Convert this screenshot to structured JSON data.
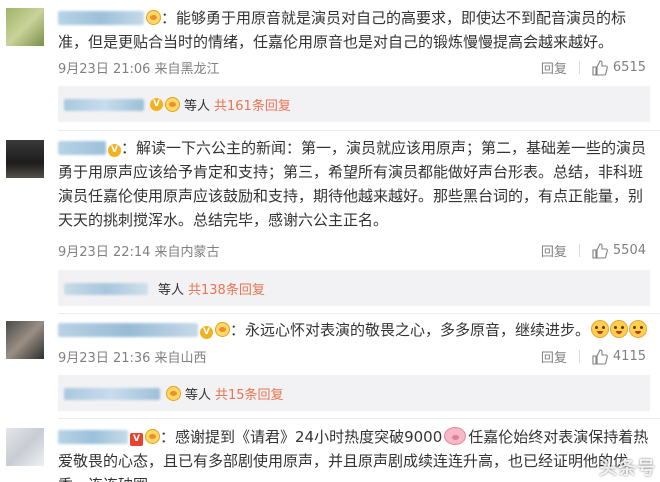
{
  "comments": [
    {
      "text": "：能够勇于用原音就是演员对自己的高要求，即使达不到配音演员的标准，但是更贴合当时的情绪，任嘉伦用原音也是对自己的锻炼慢慢提高会越来越好。",
      "time": "9月23日 21:06 来自黑龙江",
      "reply_label": "回复",
      "likes": "6515",
      "replies": {
        "etc": "等人",
        "link": "共161条回复"
      }
    },
    {
      "text": "：解读一下六公主的新闻：第一，演员就应该用原声；第二，基础差一些的演员勇于用原声应该给予肯定和支持；第三，希望所有演员都能做好声台形表。总结，非科班演员任嘉伦使用原声应该鼓励和支持，期待他越来越好。那些黑台词的，有点正能量，别天天的挑刺搅浑水。总结完毕，感谢六公主正名。",
      "time": "9月23日 22:14 来自内蒙古",
      "reply_label": "回复",
      "likes": "5504",
      "replies": {
        "etc": "等人",
        "link": "共138条回复"
      }
    },
    {
      "text": "：永远心怀对表演的敬畏之心，多多原音，继续进步。",
      "time": "9月23日 21:36 来自山西",
      "reply_label": "回复",
      "likes": "4115",
      "replies": {
        "etc": "等人",
        "link": "共15条回复"
      }
    },
    {
      "text_a": "：感谢提到《请君》24小时热度突破9000",
      "text_b": "任嘉伦始终对表演保持着热爱敬畏的心态，且已有多部剧使用原声，并且原声剧成续连连升高，也已经证明他的优秀。连连破圈"
    }
  ],
  "watermark": "头条号",
  "colors": {
    "link": "#eb7350",
    "meta": "#808080",
    "reply_bg": "#f2f2f5"
  }
}
